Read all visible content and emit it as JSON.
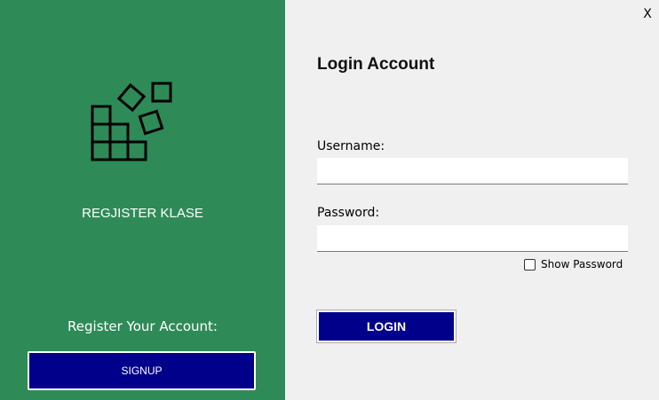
{
  "left_panel": {
    "background": "#2e8b57",
    "logo_icon": "stacked-blocks-logo-icon",
    "app_name": "REGJISTER KLASE",
    "register_label": "Register Your Account:",
    "signup_label": "SIGNUP"
  },
  "window": {
    "close_label": "X"
  },
  "form": {
    "title": "Login Account",
    "username_label": "Username:",
    "username_value": "",
    "password_label": "Password:",
    "password_value": "",
    "show_password_label": "Show Password",
    "show_password_checked": false,
    "login_label": "LOGIN"
  },
  "colors": {
    "accent": "#00008b",
    "panel": "#2e8b57",
    "background": "#f0f0f0"
  }
}
